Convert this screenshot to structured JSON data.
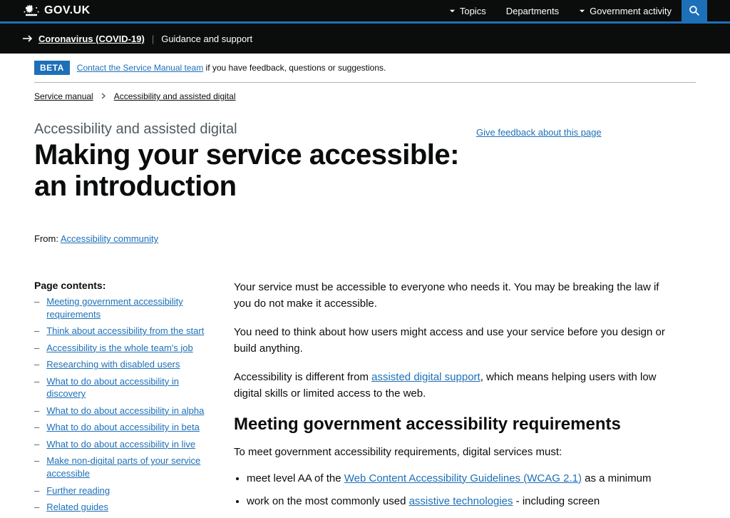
{
  "header": {
    "logo_text": "GOV.UK",
    "nav": [
      "Topics",
      "Departments",
      "Government activity"
    ]
  },
  "covid": {
    "link": "Coronavirus (COVID-19)",
    "text": "Guidance and support"
  },
  "beta": {
    "tag": "BETA",
    "link": "Contact the Service Manual team",
    "text_after": " if you have feedback, questions or suggestions."
  },
  "breadcrumb": {
    "items": [
      "Service manual",
      "Accessibility and assisted digital"
    ]
  },
  "title": {
    "super": "Accessibility and assisted digital",
    "heading": "Making your service accessible: an introduction",
    "feedback_link": "Give feedback about this page"
  },
  "from": {
    "label": "From:",
    "link": "Accessibility community"
  },
  "toc": {
    "heading": "Page contents:",
    "items": [
      "Meeting government accessibility requirements",
      "Think about accessibility from the start",
      "Accessibility is the whole team's job",
      "Researching with disabled users",
      "What to do about accessibility in discovery",
      "What to do about accessibility in alpha",
      "What to do about accessibility in beta",
      "What to do about accessibility in live",
      "Make non-digital parts of your service accessible",
      "Further reading",
      "Related guides"
    ]
  },
  "body": {
    "p1": "Your service must be accessible to everyone who needs it. You may be breaking the law if you do not make it accessible.",
    "p2": "You need to think about how users might access and use your service before you design or build anything.",
    "p3_before": "Accessibility is different from ",
    "p3_link": "assisted digital support",
    "p3_after": ", which means helping users with low digital skills or limited access to the web.",
    "h2": "Meeting government accessibility requirements",
    "lead": "To meet government accessibility requirements, digital services must:",
    "li1_before": "meet level AA of the ",
    "li1_link": "Web Content Accessibility Guidelines (WCAG 2.1)",
    "li1_after": " as a minimum",
    "li2_before": "work on the most commonly used ",
    "li2_link": "assistive technologies",
    "li2_after": " - including screen"
  }
}
